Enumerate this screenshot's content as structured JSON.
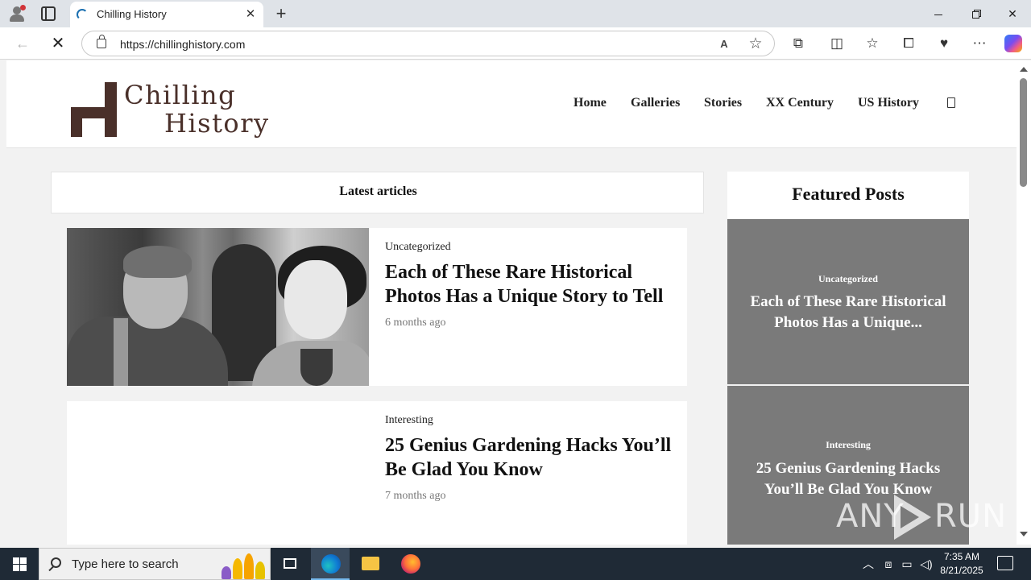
{
  "browser": {
    "tab_title": "Chilling History",
    "tab_close": "✕",
    "new_tab": "+",
    "url": "https://chillinghistory.com",
    "read_aloud": "A",
    "window_controls": {
      "minimize": "—",
      "maximize": "☐",
      "close": "✕"
    }
  },
  "site": {
    "logo_line1": "Chilling",
    "logo_line2": "History",
    "nav": [
      "Home",
      "Galleries",
      "Stories",
      "XX Century",
      "US History"
    ],
    "latest_heading": "Latest articles",
    "articles": [
      {
        "category": "Uncategorized",
        "title": "Each of These Rare Historical Photos Has a Unique Story to Tell",
        "date": "6 months ago"
      },
      {
        "category": "Interesting",
        "title": "25 Genius Gardening Hacks You’ll Be Glad You Know",
        "date": "7 months ago"
      }
    ],
    "featured_heading": "Featured Posts",
    "featured": [
      {
        "category": "Uncategorized",
        "title": "Each of These Rare Historical Photos Has a Unique..."
      },
      {
        "category": "Interesting",
        "title": "25 Genius Gardening Hacks You’ll Be Glad You Know"
      }
    ]
  },
  "watermark": {
    "left": "ANY",
    "right": "RUN"
  },
  "taskbar": {
    "search_placeholder": "Type here to search",
    "time": "7:35 AM",
    "date": "8/21/2025"
  },
  "icons": {
    "search": "search-icon",
    "lock": "lock-icon",
    "star": "favorite-star-icon",
    "extensions": "puzzle-icon",
    "split": "split-screen-icon",
    "favorites": "favorites-icon",
    "collections": "collections-icon",
    "more": "more-icon"
  },
  "colors": {
    "logo_brown": "#4a302a",
    "featured_card_bg": "#7a7a7a",
    "taskbar_bg": "#1f2a36"
  }
}
